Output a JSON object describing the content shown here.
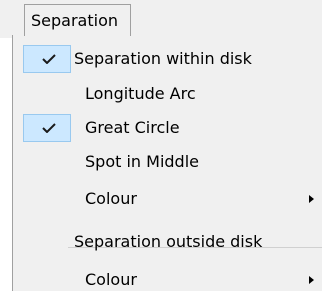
{
  "menu": {
    "title": "Separation",
    "items": [
      {
        "label": "Separation within disk",
        "checked": true
      },
      {
        "label": "Longitude Arc",
        "checked": false
      },
      {
        "label": "Great Circle",
        "checked": true
      },
      {
        "label": "Spot in Middle",
        "checked": false
      },
      {
        "label": "Colour",
        "submenu": true
      },
      {
        "label": "Separation outside disk",
        "checked": false
      },
      {
        "label": "Colour",
        "submenu": true
      }
    ]
  },
  "colors": {
    "menu_background": "#f0f0f0",
    "check_highlight": "#cce8ff",
    "check_border": "#99c9ef"
  },
  "icons": {
    "check": "check-icon",
    "submenu": "chevron-right-icon"
  }
}
